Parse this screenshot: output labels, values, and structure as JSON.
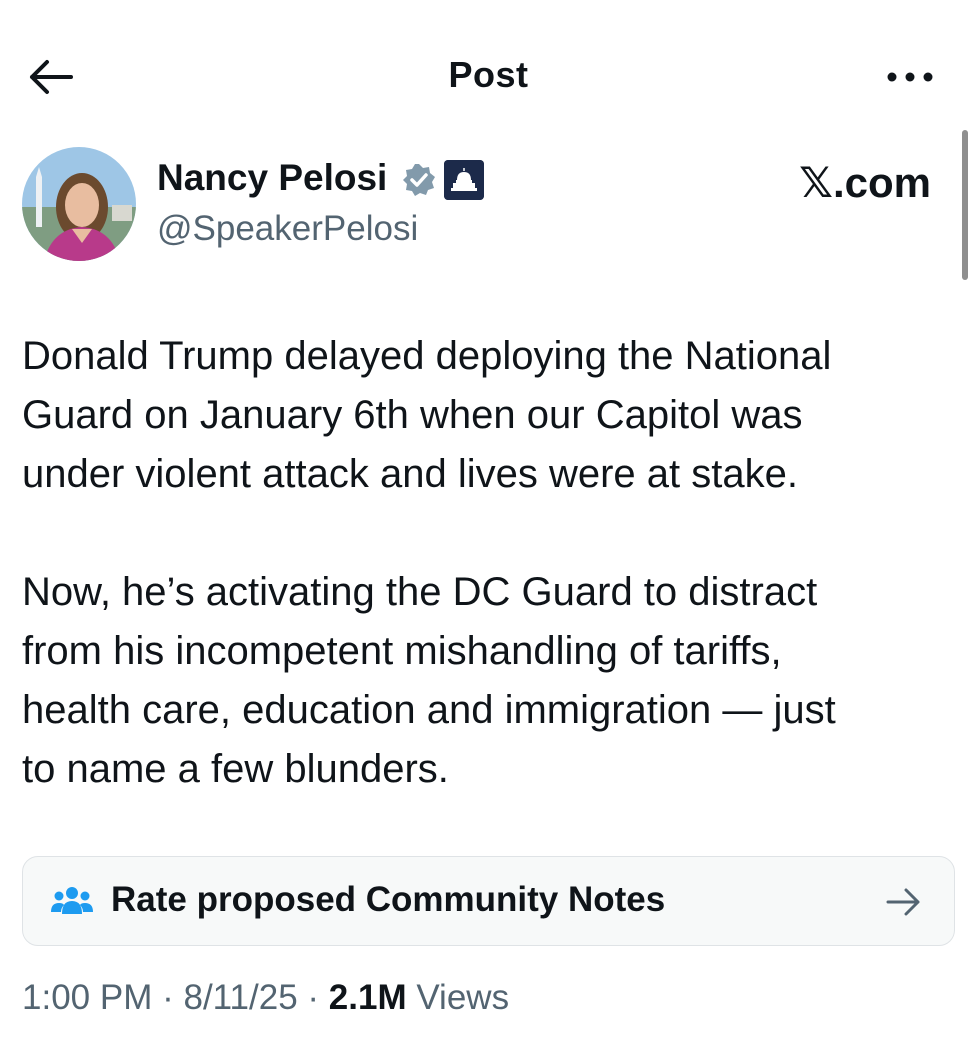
{
  "header": {
    "title": "Post",
    "back_icon": "arrow-left-icon",
    "more_icon": "more-horizontal-icon"
  },
  "post": {
    "author_name": "Nancy Pelosi",
    "author_handle": "@SpeakerPelosi",
    "verified_icon": "verified-badge-icon",
    "affiliation_icon": "capitol-building-icon",
    "source_label": "𝕏.com",
    "paragraphs": [
      [
        "Donald Trump delayed deploying the National",
        "Guard on January 6th when our Capitol was",
        "under violent attack and lives were at stake."
      ],
      [
        "Now, he’s activating the DC Guard to distract",
        "from his incompetent mishandling of tariffs,",
        "health care, education and immigration — just",
        "to name a few blunders."
      ]
    ],
    "community_notes_label": "Rate proposed Community Notes",
    "community_notes_icon": "people-group-icon",
    "community_notes_arrow": "arrow-right-icon",
    "time": "1:00 PM",
    "separator": "·",
    "date": "8/11/25",
    "views_count": "2.1M",
    "views_label": "Views"
  },
  "colors": {
    "text_primary": "#0f1419",
    "text_secondary": "#536471",
    "verified_badge": "#829aab",
    "notes_icon": "#1d9bf0",
    "card_background": "#f7f9f9"
  }
}
